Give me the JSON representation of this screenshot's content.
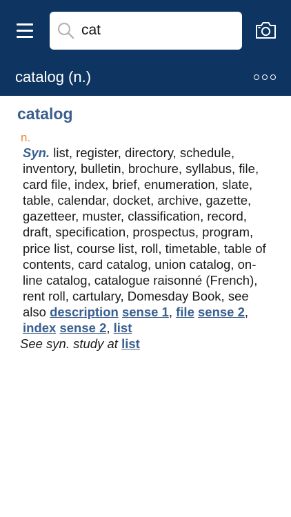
{
  "header": {
    "search_value": "cat",
    "entry_title": "catalog (n.)",
    "menu_icon": "hamburger-menu-icon",
    "search_icon": "magnifier-icon",
    "camera_icon": "camera-icon",
    "more_icon": "more-dots-icon",
    "bg_color": "#0e3562"
  },
  "entry": {
    "headword": "catalog",
    "pos": "n.",
    "syn_label": "Syn.",
    "synonyms": "list, register, directory, schedule, inventory, bulletin, brochure, syllabus, file, card file, index, brief, enumeration, slate, table, calendar, docket, archive, gazette, gazetteer, muster, classification, record, draft, specification, prospectus, program, price list, course list, roll, timetable, table of contents, card catalog, union catalog, on-line catalog, catalogue raisonné (French), rent roll, cartulary, Domesday Book, see also",
    "refs": [
      {
        "word": "description",
        "sense": "sense 1",
        "sep": ","
      },
      {
        "word": "file",
        "sense": "sense 2",
        "sep": ","
      },
      {
        "word": "index",
        "sense": "sense 2",
        "sep": ","
      },
      {
        "word": "list",
        "sense": "",
        "sep": ""
      }
    ],
    "study_label": "See syn. study at",
    "study_link": "list",
    "accent_color": "#3a5f8f",
    "pos_color": "#e4892c"
  }
}
